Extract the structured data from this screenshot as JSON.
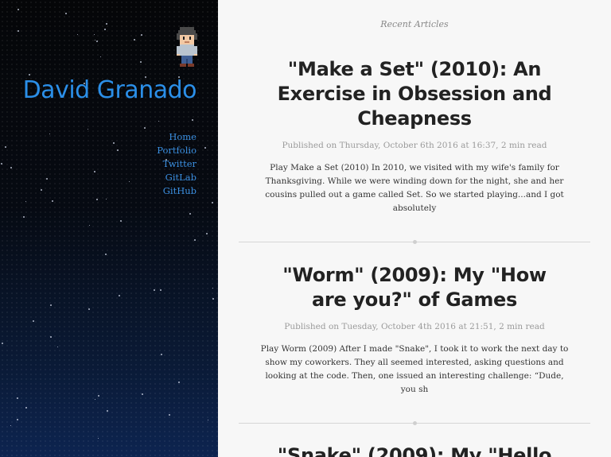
{
  "sidebar": {
    "site_title": "David Granado",
    "nav": [
      "Home",
      "Portfolio",
      "Twitter",
      "GitLab",
      "GitHub"
    ]
  },
  "main": {
    "section_label": "Recent Articles",
    "articles": [
      {
        "title": "\"Make a Set\" (2010): An Exercise in Obsession and Cheapness",
        "meta": "Published on Thursday, October 6th 2016 at 16:37, 2 min read",
        "excerpt": "Play Make a Set (2010) In 2010, we visited with my wife's family for Thanksgiving. While we were winding down for the night, she and her cousins pulled out a game called Set. So we started playing...and I got absolutely"
      },
      {
        "title": "\"Worm\" (2009): My \"How are you?\" of Games",
        "meta": "Published on Tuesday, October 4th 2016 at 21:51, 2 min read",
        "excerpt": "Play Worm (2009) After I made \"Snake\", I took it to work the next day to show my coworkers. They all seemed interested, asking questions and looking at the code. Then, one issued an interesting challenge: “Dude, you sh"
      },
      {
        "title": "\"Snake\" (2009): My \"Hello",
        "meta": "",
        "excerpt": ""
      }
    ]
  },
  "colors": {
    "accent": "#2b8fe8",
    "sidebar_bg": "#050608",
    "main_bg": "#f7f7f7"
  }
}
